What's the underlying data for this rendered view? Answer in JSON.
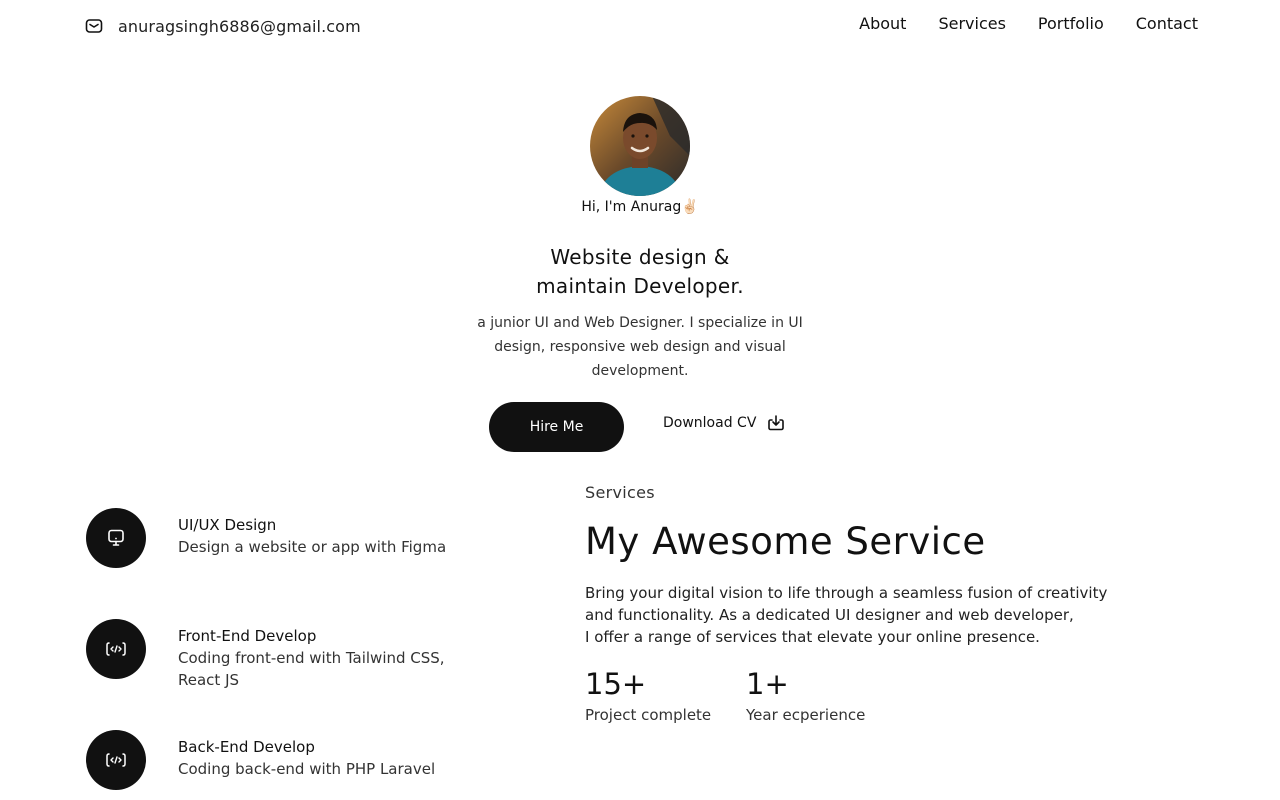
{
  "header": {
    "email": "anuragsingh6886@gmail.com",
    "email_icon": "mail-icon",
    "nav": [
      {
        "label": "About"
      },
      {
        "label": "Services"
      },
      {
        "label": "Portfolio"
      },
      {
        "label": "Contact"
      }
    ]
  },
  "hero": {
    "greeting": "Hi, I'm Anurag✌🏻",
    "headline_line1": "Website design &",
    "headline_line2": "maintain Developer.",
    "tagline": "a junior UI and Web Designer. I specialize in UI design, responsive web design and visual development.",
    "hire_button": "Hire Me",
    "download_cv": "Download CV",
    "download_icon": "download-icon"
  },
  "services": [
    {
      "title": "UI/UX Design",
      "description": "Design a website or app with Figma",
      "icon": "monitor-icon"
    },
    {
      "title": "Front-End Develop",
      "description": "Coding front-end with Tailwind CSS, React JS",
      "icon": "code-icon"
    },
    {
      "title": "Back-End Develop",
      "description": "Coding back-end with PHP Laravel",
      "icon": "code-icon"
    }
  ],
  "about_services": {
    "label": "Services",
    "title": "My Awesome Service",
    "description_line1": "Bring your digital vision to life through a seamless fusion of creativity",
    "description_line2": "and functionality. As a dedicated UI designer and web developer,",
    "description_line3": "I offer a range of services that elevate your online presence.",
    "stats": [
      {
        "value": "15+",
        "label": "Project complete"
      },
      {
        "value": "1+",
        "label": "Year ecperience"
      }
    ]
  },
  "colors": {
    "accent": "#111111",
    "background": "#ffffff",
    "text": "#111111"
  }
}
